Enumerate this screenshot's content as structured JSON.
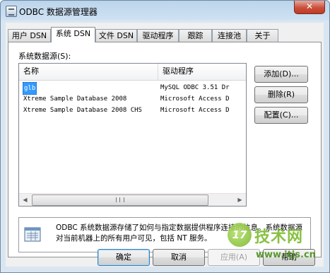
{
  "window": {
    "title": "ODBC 数据源管理器",
    "close_glyph": "✕"
  },
  "tabs": [
    "用户 DSN",
    "系统 DSN",
    "文件 DSN",
    "驱动程序",
    "跟踪",
    "连接池",
    "关于"
  ],
  "active_tab": "系统 DSN",
  "section_label": "系统数据源(S):",
  "list": {
    "columns": [
      "名称",
      "驱动程序"
    ],
    "rows": [
      {
        "name": "glb",
        "driver": "MySQL ODBC 3.51 Dr",
        "selected": true
      },
      {
        "name": "Xtreme Sample Database 2008",
        "driver": "Microsoft Access D"
      },
      {
        "name": "Xtreme Sample Database 2008 CHS",
        "driver": "Microsoft Access D"
      }
    ],
    "scroll_grip": "||||"
  },
  "buttons": {
    "add": "添加(D)...",
    "remove": "删除(R)",
    "configure": "配置(C)..."
  },
  "info": {
    "icon": "data-source-icon",
    "text": "ODBC 系统数据源存储了如何与指定数据提供程序连接的信息。系统数据源对当前机器上的所有用户可见，包括 NT 服务。"
  },
  "footer": {
    "ok": "确定",
    "cancel": "取消",
    "apply": "应用(A)",
    "help": "帮助"
  },
  "watermark": {
    "logo_text": "17",
    "name": "技术网",
    "url": "www.itjs.cn"
  }
}
